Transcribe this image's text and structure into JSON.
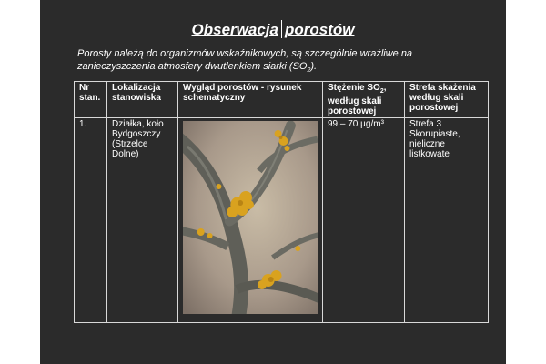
{
  "title": {
    "word1": "Obserwacja",
    "word2": "porostów"
  },
  "intro": {
    "line1": "Porosty należą do organizmów wskaźnikowych, są szczególnie wrażliwe na",
    "line2_pre": "zanieczyszczenia atmosfery dwutlenkiem siarki (SO",
    "line2_sub": "2",
    "line2_post": ")."
  },
  "table": {
    "headers": {
      "nr": "Nr stan.",
      "lokalizacja": "Lokalizacja stanowiska",
      "wyglad": "Wygląd porostów - rysunek schematyczny",
      "stezenie_pre": "Stężenie SO",
      "stezenie_sub": "2",
      "stezenie_post": ", według skali porostowej",
      "strefa": "Strefa skażenia według skali porostowej"
    },
    "row": {
      "nr": "1.",
      "lokalizacja": "Działka, koło Bydgoszczy (Strzelce Dolne)",
      "stezenie": "99 – 70 µg/m³",
      "strefa": "Strefa 3 Skorupiaste, nieliczne listkowate"
    }
  },
  "colors": {
    "slide_bg": "#2b2b2b",
    "text": "#ffffff",
    "lichen": "#d9a21f",
    "branch": "#6e6e66"
  }
}
